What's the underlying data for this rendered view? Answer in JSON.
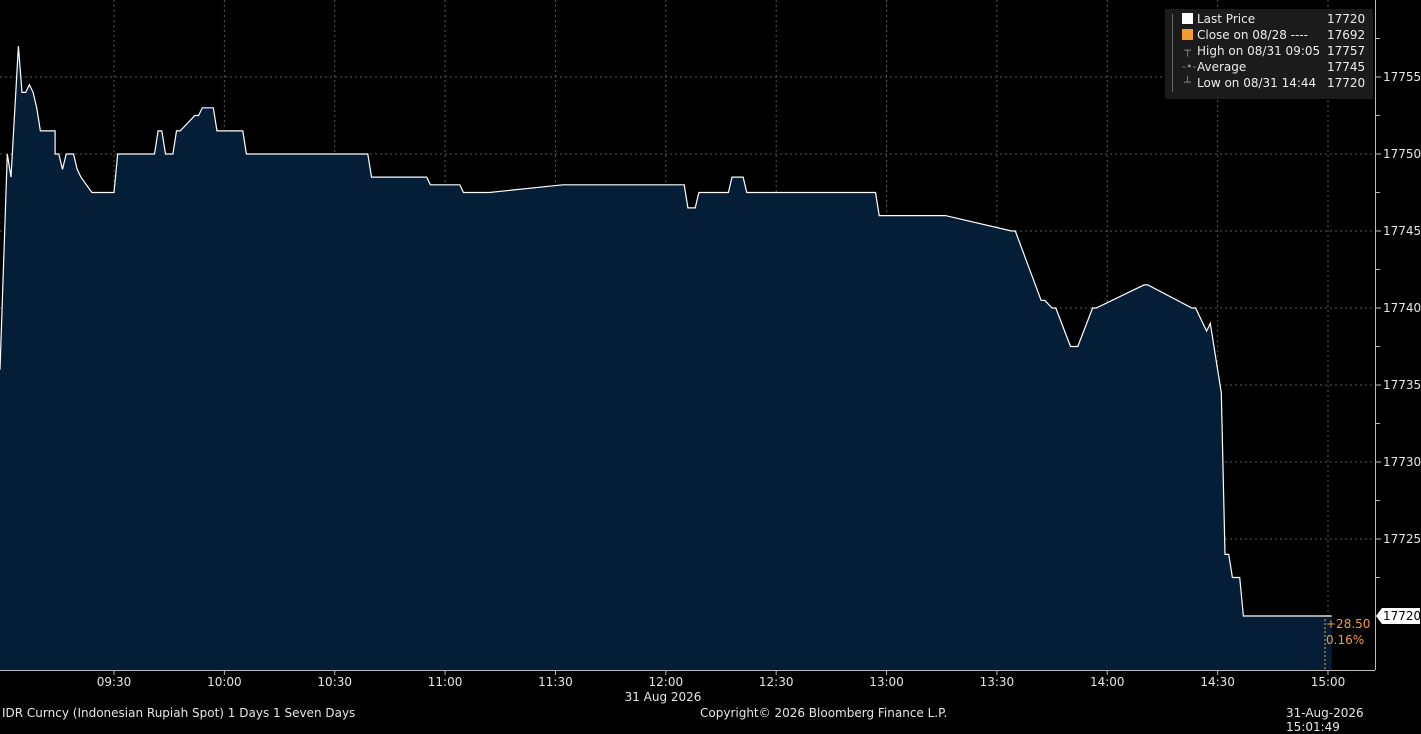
{
  "legend": {
    "rows": [
      {
        "label": "Last Price",
        "value": "17720",
        "marker": "white-square"
      },
      {
        "label": "Close on 08/28 ----",
        "value": "17692",
        "marker": "orange-square"
      },
      {
        "label": "High on 08/31 09:05",
        "value": "17757",
        "marker": "high-tick"
      },
      {
        "label": "Average",
        "value": "17745",
        "marker": "average-dot"
      },
      {
        "label": "Low on 08/31 14:44",
        "value": "17720",
        "marker": "low-tick"
      }
    ]
  },
  "last_tag": "17720",
  "change": {
    "abs": "+28.50",
    "pct": "0.16%"
  },
  "date_label": "31 Aug 2026",
  "footer": {
    "left": "IDR Curncy (Indonesian Rupiah Spot) 1 Days 1 Seven Days",
    "center": "Copyright© 2026 Bloomberg Finance L.P.",
    "right": "31-Aug-2026 15:01:49"
  },
  "colors": {
    "fill": "#051e38",
    "line": "#ffffff",
    "grid": "#5a5a5a",
    "orange": "#f39c33"
  },
  "chart_data": {
    "type": "area",
    "x_ticks": [
      "09:30",
      "10:00",
      "10:30",
      "11:00",
      "11:30",
      "12:00",
      "12:30",
      "13:00",
      "13:30",
      "14:00",
      "14:30",
      "15:00"
    ],
    "y_ticks": [
      17725,
      17730,
      17735,
      17740,
      17745,
      17750,
      17755
    ],
    "ylim": [
      17717,
      17760
    ],
    "xlim": [
      "09:00",
      "15:10"
    ],
    "grid": true,
    "legend_position": "top-right",
    "series": [
      {
        "name": "Last Price",
        "x": [
          "09:00",
          "09:01",
          "09:02",
          "09:04",
          "09:05",
          "09:06",
          "09:07",
          "09:08",
          "09:09",
          "09:10",
          "09:11",
          "09:14",
          "09:14",
          "09:15",
          "09:16",
          "09:17",
          "09:18",
          "09:19",
          "09:20",
          "09:21",
          "09:24",
          "09:30",
          "09:31",
          "09:41",
          "09:42",
          "09:43",
          "09:44",
          "09:46",
          "09:47",
          "09:48",
          "09:52",
          "09:53",
          "09:54",
          "09:57",
          "09:58",
          "10:00",
          "10:05",
          "10:06",
          "10:39",
          "10:40",
          "10:55",
          "10:56",
          "11:04",
          "11:05",
          "11:11",
          "11:12",
          "11:32",
          "11:33",
          "12:05",
          "12:06",
          "12:08",
          "12:09",
          "12:17",
          "12:18",
          "12:21",
          "12:22",
          "12:40",
          "12:41",
          "12:57",
          "12:58",
          "13:15",
          "13:16",
          "13:34",
          "13:35",
          "13:42",
          "13:43",
          "13:45",
          "13:46",
          "13:50",
          "13:52",
          "13:56",
          "13:57",
          "14:10",
          "14:11",
          "14:23",
          "14:24",
          "14:27",
          "14:28",
          "14:30",
          "14:31",
          "14:32",
          "14:33",
          "14:34",
          "14:35",
          "14:36",
          "14:37",
          "14:39",
          "14:40",
          "14:42",
          "14:43",
          "14:44",
          "15:00",
          "15:01"
        ],
        "values": [
          17736,
          17750,
          17748.5,
          17757,
          17754,
          17754,
          17754.5,
          17754,
          17753,
          17751.5,
          17751.5,
          17751.5,
          17750,
          17750,
          17749,
          17750,
          17750,
          17750,
          17749,
          17748.5,
          17747.5,
          17747.5,
          17750,
          17750,
          17751.5,
          17751.5,
          17750,
          17750,
          17751.5,
          17751.5,
          17752.5,
          17752.5,
          17753,
          17753,
          17751.5,
          17751.5,
          17751.5,
          17750,
          17750,
          17748.5,
          17748.5,
          17748,
          17748,
          17747.5,
          17747.5,
          17747.5,
          17748,
          17748,
          17748,
          17746.5,
          17746.5,
          17747.5,
          17747.5,
          17748.5,
          17748.5,
          17747.5,
          17747.5,
          17747.5,
          17747.5,
          17746,
          17746,
          17746,
          17745,
          17745,
          17740.5,
          17740.5,
          17740,
          17740,
          17737.5,
          17737.5,
          17740,
          17740,
          17741.5,
          17741.5,
          17740,
          17740,
          17738.5,
          17739,
          17736,
          17734.5,
          17724,
          17724,
          17722.5,
          17722.5,
          17722.5,
          17720,
          17720,
          17720,
          17720,
          17720,
          17720,
          17720,
          17720
        ]
      }
    ]
  }
}
